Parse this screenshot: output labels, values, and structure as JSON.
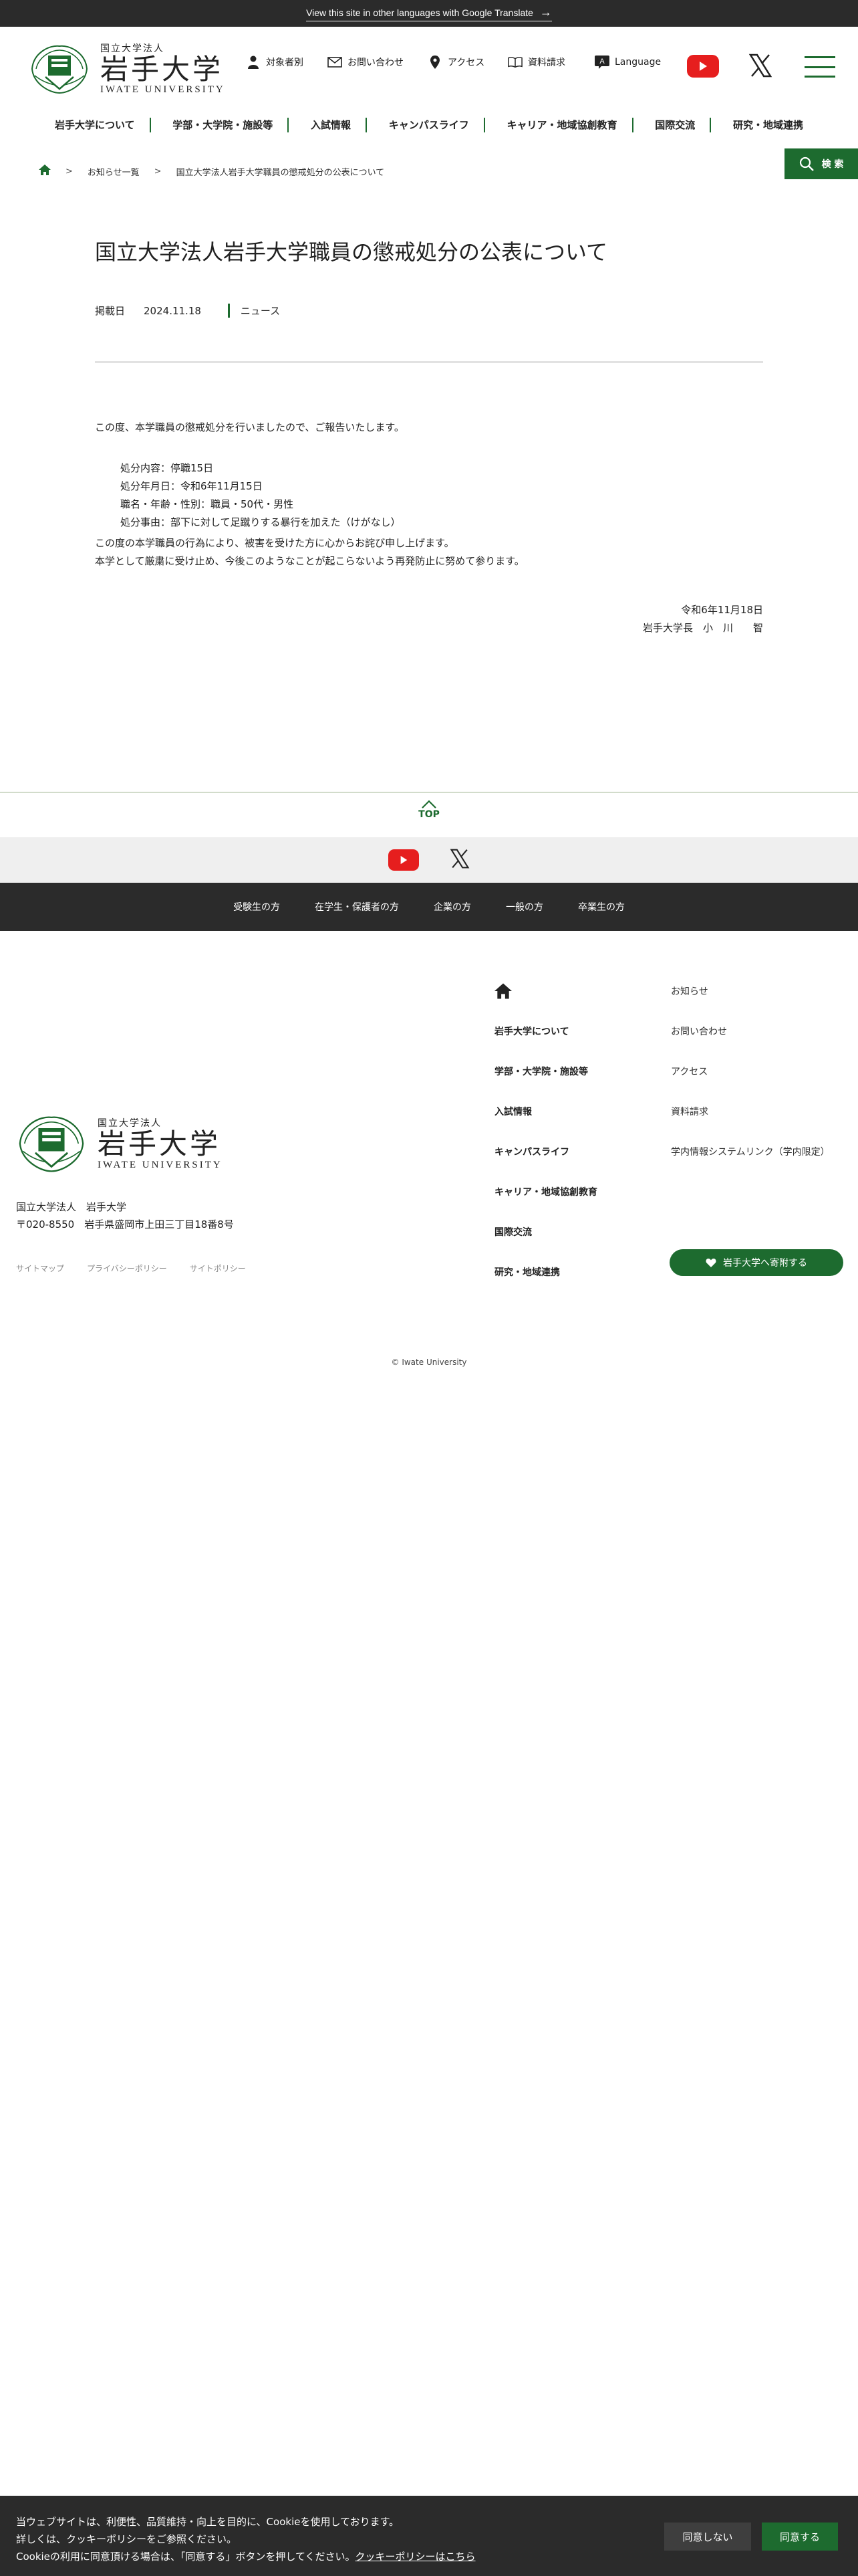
{
  "translate_bar": {
    "text": "View this site in other languages with Google Translate"
  },
  "logo": {
    "sub": "国立大学法人",
    "main": "岩手大学",
    "en": "IWATE UNIVERSITY"
  },
  "utility": [
    {
      "label": "対象者別",
      "icon": "person-icon"
    },
    {
      "label": "お問い合わせ",
      "icon": "mail-icon"
    },
    {
      "label": "アクセス",
      "icon": "pin-icon"
    },
    {
      "label": "資料請求",
      "icon": "book-icon"
    },
    {
      "label": "Language",
      "icon": "language-icon"
    }
  ],
  "gnav": [
    "岩手大学について",
    "学部・大学院・施設等",
    "入試情報",
    "キャンパスライフ",
    "キャリア・地域協創教育",
    "国際交流",
    "研究・地域連携"
  ],
  "breadcrumb": {
    "list": "お知らせ一覧",
    "current": "国立大学法人岩手大学職員の懲戒処分の公表について"
  },
  "search": {
    "label": "検 索"
  },
  "article": {
    "title": "国立大学法人岩手大学職員の懲戒処分の公表について",
    "meta_label": "掲載日",
    "date": "2024.11.18",
    "category": "ニュース",
    "intro": "この度、本学職員の懲戒処分を行いましたので、ご報告いたします。",
    "details": [
      "処分内容：停職15日",
      "処分年月日：令和6年11月15日",
      "職名・年齢・性別：職員・50代・男性",
      "処分事由：部下に対して足蹴りする暴行を加えた（けがなし）"
    ],
    "after": [
      "この度の本学職員の行為により、被害を受けた方に心からお詫び申し上げます。",
      "本学として厳粛に受け止め、今後このようなことが起こらないよう再発防止に努めて参ります。"
    ],
    "sign_date": "令和6年11月18日",
    "sign_name": "岩手大学長　小　川　　智"
  },
  "top_button": {
    "label": "TOP"
  },
  "target_bar": [
    "受験生の方",
    "在学生・保護者の方",
    "企業の方",
    "一般の方",
    "卒業生の方"
  ],
  "footer": {
    "address": [
      "国立大学法人　岩手大学",
      "〒020-8550　岩手県盛岡市上田三丁目18番8号"
    ],
    "links": [
      "サイトマップ",
      "プライバシーポリシー",
      "サイトポリシー"
    ],
    "nav_col1": [
      "岩手大学について",
      "学部・大学院・施設等",
      "入試情報",
      "キャンパスライフ",
      "キャリア・地域協創教育",
      "国際交流",
      "研究・地域連携"
    ],
    "nav_col2": [
      "お知らせ",
      "お問い合わせ",
      "アクセス",
      "資料請求",
      "学内情報システムリンク（学内限定）"
    ],
    "donate": "岩手大学へ寄附する",
    "copyright": "© Iwate University"
  },
  "cookie": {
    "line1": "当ウェブサイトは、利便性、品質維持・向上を目的に、Cookieを使用しております。",
    "line2": "詳しくは、クッキーポリシーをご参照ください。",
    "line3": "Cookieの利用に同意頂ける場合は、「同意する」ボタンを押してください。",
    "link": "クッキーポリシーはこちら",
    "deny": "同意しない",
    "accept": "同意する"
  },
  "colors": {
    "brand_green": "#1d6b2f",
    "dark_bar": "#2b2b2b",
    "youtube_red": "#e61e1e"
  }
}
